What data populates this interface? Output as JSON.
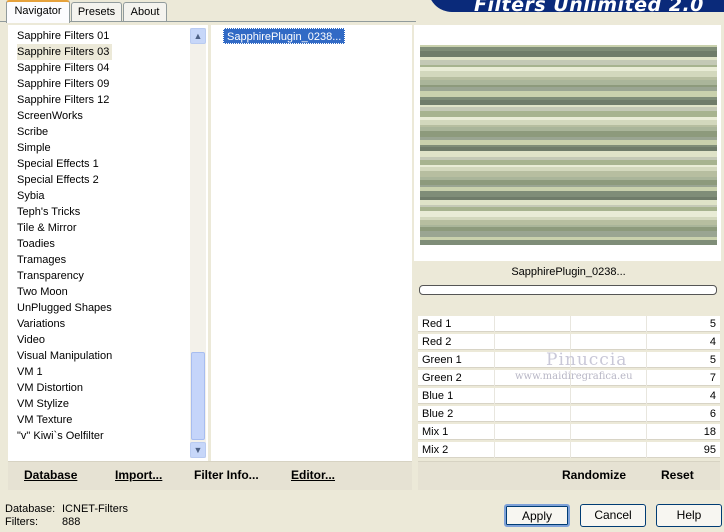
{
  "banner": {
    "title": "Filters Unlimited 2.0"
  },
  "tabs": [
    {
      "label": "Navigator"
    },
    {
      "label": "Presets"
    },
    {
      "label": "About"
    }
  ],
  "categories": [
    "Sapphire Filters 01",
    "Sapphire Filters 03",
    "Sapphire Filters 04",
    "Sapphire Filters 09",
    "Sapphire Filters 12",
    "ScreenWorks",
    "Scribe",
    "Simple",
    "Special Effects 1",
    "Special Effects 2",
    "Sybia",
    "Teph's Tricks",
    "Tile & Mirror",
    "Toadies",
    "Tramages",
    "Transparency",
    "Two Moon",
    "UnPlugged Shapes",
    "Variations",
    "Video",
    "Visual Manipulation",
    "VM 1",
    "VM Distortion",
    "VM Stylize",
    "VM Texture",
    "\"v\" Kiwi`s Oelfilter"
  ],
  "selected_category": "Sapphire Filters 03",
  "filter_list": {
    "selected": "SapphirePlugin_0238..."
  },
  "preview": {
    "caption": "SapphirePlugin_0238..."
  },
  "sliders": [
    {
      "label": "Red 1",
      "value": "5"
    },
    {
      "label": "Red 2",
      "value": "4"
    },
    {
      "label": "Green 1",
      "value": "5"
    },
    {
      "label": "Green 2",
      "value": "7"
    },
    {
      "label": "Blue 1",
      "value": "4"
    },
    {
      "label": "Blue 2",
      "value": "6"
    },
    {
      "label": "Mix 1",
      "value": "18"
    },
    {
      "label": "Mix 2",
      "value": "95"
    }
  ],
  "watermark": {
    "name": "Pinuccia",
    "url": "www.maidiregrafica.eu"
  },
  "toolbar_left": {
    "database": "Database",
    "import": "Import...",
    "filter_info": "Filter Info...",
    "editor": "Editor..."
  },
  "toolbar_right": {
    "randomize": "Randomize",
    "reset": "Reset"
  },
  "status": {
    "database_label": "Database:",
    "database_value": "ICNET-Filters",
    "filters_label": "Filters:",
    "filters_value": "888"
  },
  "buttons": {
    "apply": "Apply",
    "cancel": "Cancel",
    "help": "Help"
  },
  "icons": {
    "scroll_up": "chevron-up-icon",
    "scroll_down": "chevron-down-icon"
  }
}
